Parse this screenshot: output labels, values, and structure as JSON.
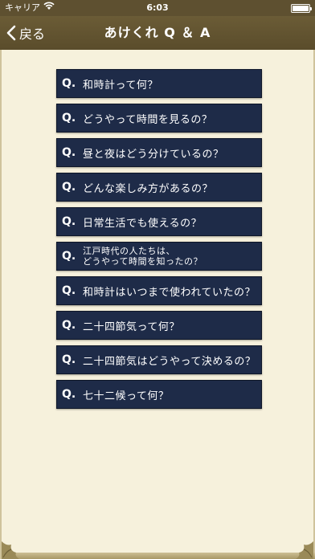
{
  "status_bar": {
    "carrier": "キャリア",
    "time": "6:03",
    "battery_level": 1.0
  },
  "nav": {
    "back_label": "戻る",
    "title": "あけくれ Q ＆ A"
  },
  "qa_prefix": "Q.",
  "questions": [
    "和時計って何？",
    "どうやって時間を見るの？",
    "昼と夜はどう分けているの？",
    "どんな楽しみ方があるの？",
    "日常生活でも使えるの？",
    "江戸時代の人たちは、\nどうやって時間を知ったの？",
    "和時計はいつまで使われていたの？",
    "二十四節気って何？",
    "二十四節気はどうやって決めるの？",
    "七十二候って何？"
  ],
  "icons": {
    "wifi": "wifi-icon",
    "back": "chevron-left-icon"
  },
  "colors": {
    "nav_background": "#5e5030",
    "content_background": "#f6f1dc",
    "button_background": "#1e2b48",
    "button_text": "#ffffff"
  }
}
